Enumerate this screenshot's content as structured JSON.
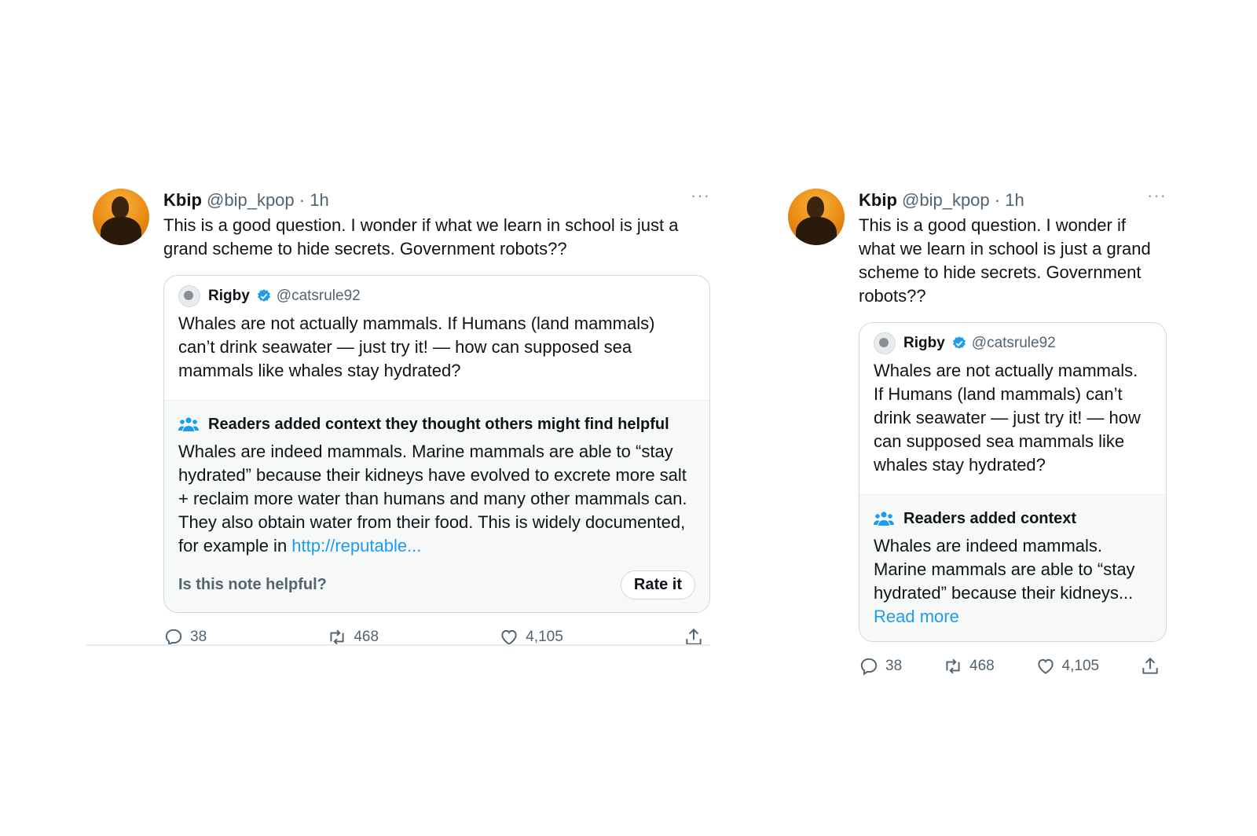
{
  "tweets": [
    {
      "author_name": "Kbip",
      "author_handle": "@bip_kpop",
      "time": "· 1h",
      "more": "···",
      "text": "This is a good question. I wonder if what we learn in school is just a grand scheme to hide secrets. Government robots??",
      "quote": {
        "name": "Rigby",
        "handle": "@catsrule92",
        "text": "Whales are not actually mammals. If Humans (land mammals) can’t drink seawater — just try it! — how can supposed sea mammals like whales stay hydrated?"
      },
      "context": {
        "heading": "Readers added context they thought others might find helpful",
        "text": "Whales are indeed mammals. Marine mammals are able to “stay hydrated” because their kidneys have evolved to excrete more salt + reclaim more water than humans and many other mammals can. They also obtain water from their food. This is widely documented, for example in ",
        "link": "http://reputable...",
        "helpful_prompt": "Is this note helpful?",
        "rate_button": "Rate it"
      },
      "stats": {
        "replies": "38",
        "retweets": "468",
        "likes": "4,105"
      }
    },
    {
      "author_name": "Kbip",
      "author_handle": "@bip_kpop",
      "time": "· 1h",
      "more": "···",
      "text": "This is a good question. I wonder if what we learn in school is just a grand scheme to hide secrets. Government robots??",
      "quote": {
        "name": "Rigby",
        "handle": "@catsrule92",
        "text": "Whales are not actually mammals. If Humans (land mammals) can’t drink seawater — just try it! — how can supposed sea mammals like whales stay hydrated?"
      },
      "context": {
        "heading": "Readers added context",
        "text": "Whales are indeed mammals. Marine mammals are able to “stay hydrated” because their kidneys...",
        "read_more": "Read more"
      },
      "stats": {
        "replies": "38",
        "retweets": "468",
        "likes": "4,105"
      }
    }
  ],
  "colors": {
    "accent": "#1d9bf0",
    "muted": "#536471",
    "text": "#0f1419",
    "context_bg": "#f7f9f9"
  },
  "icons": [
    "reply-icon",
    "retweet-icon",
    "like-icon",
    "share-icon",
    "verified-badge-icon",
    "people-icon",
    "more-icon"
  ]
}
